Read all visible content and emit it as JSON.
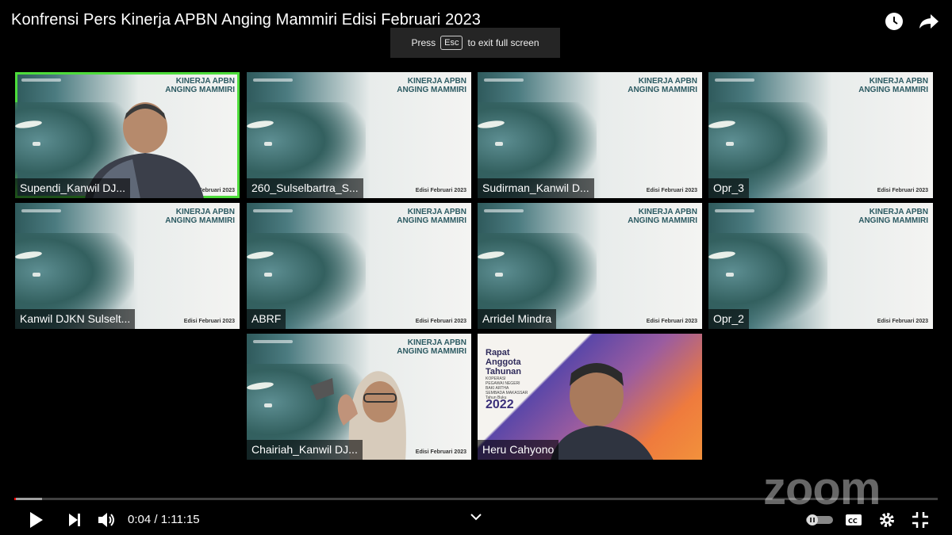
{
  "header": {
    "title": "Konfrensi Pers Kinerja APBN Anging Mammiri Edisi Februari 2023",
    "icons": [
      "watch-later-icon",
      "share-icon"
    ]
  },
  "toast": {
    "press": "Press",
    "key": "Esc",
    "suffix": "to exit full screen"
  },
  "slide": {
    "brand_line1": "KINERJA APBN",
    "brand_line2": "ANGING MAMMIRI",
    "edition": "Edisi Februari 2023"
  },
  "participants": [
    {
      "name": "Supendi_Kanwil DJ...",
      "active": true
    },
    {
      "name": "260_Sulselbartra_S..."
    },
    {
      "name": "Sudirman_Kanwil D..."
    },
    {
      "name": "Opr_3"
    },
    {
      "name": "Kanwil DJKN Sulselt..."
    },
    {
      "name": "ABRF"
    },
    {
      "name": "Arridel Mindra"
    },
    {
      "name": "Opr_2"
    },
    {
      "name": "Chairiah_Kanwil DJ..."
    },
    {
      "name": "Heru Cahyono"
    }
  ],
  "poster": {
    "line1": "Rapat",
    "line2": "Anggota",
    "line3": "Tahunan",
    "sub1": "KOPERASI",
    "sub2": "PEGAWAI NEGERI",
    "sub3": "BAKI ARTHA",
    "sub4": "SEMBADA MAKASSAR",
    "sub5": "Tahun Buku",
    "year": "2022"
  },
  "watermark": "zoom",
  "player": {
    "current_time": "0:04",
    "separator": " / ",
    "duration": "1:11:15",
    "progress_fraction": 0.0006,
    "buffer_fraction": 0.03
  }
}
